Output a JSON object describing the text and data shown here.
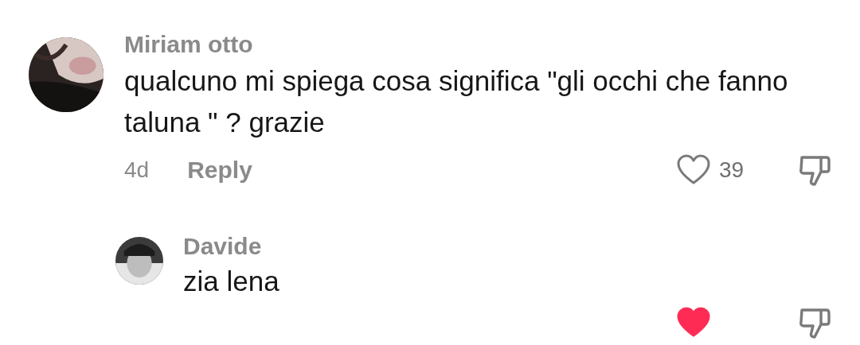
{
  "comments": [
    {
      "author": "Miriam otto",
      "text": "qualcuno mi spiega cosa significa \"gli occhi che fanno taluna \" ? grazie",
      "time": "4d",
      "reply_label": "Reply",
      "likes": "39",
      "liked": false,
      "replies": [
        {
          "author": "Davide",
          "text": "zia lena",
          "liked": true
        }
      ]
    }
  ]
}
